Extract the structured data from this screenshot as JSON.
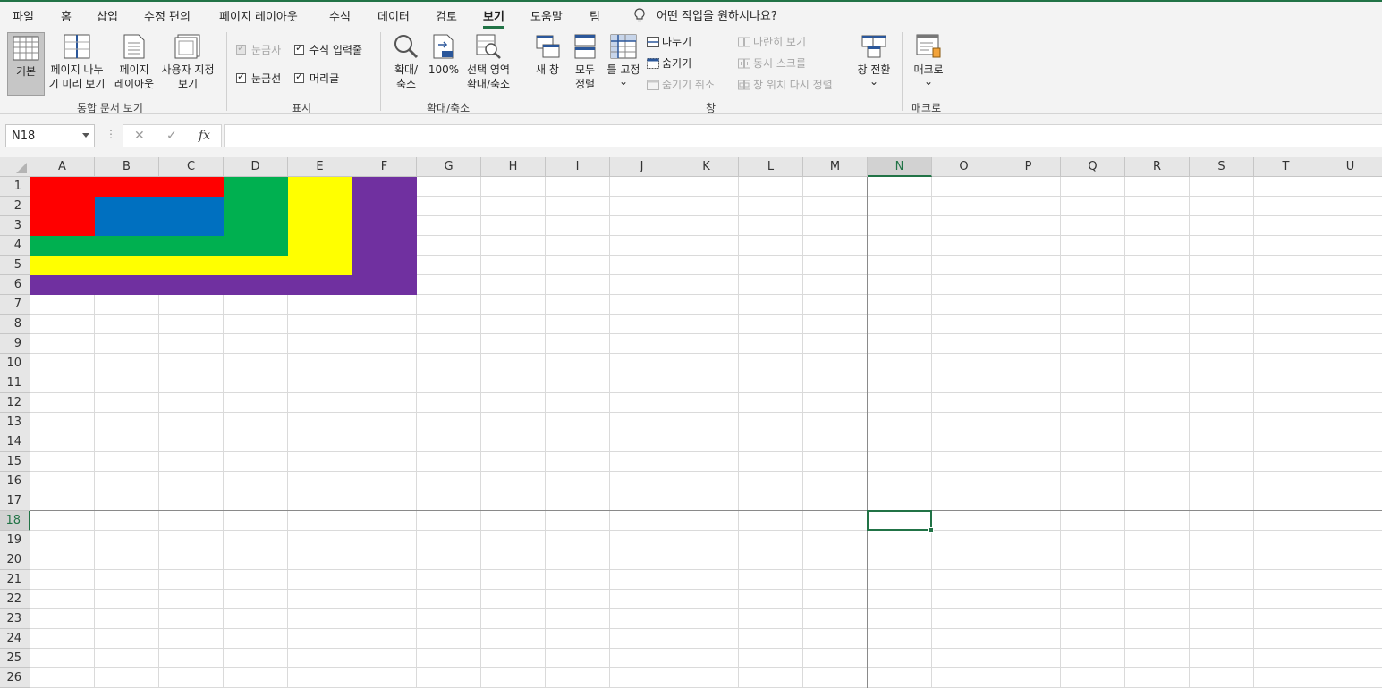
{
  "menu": {
    "items": [
      "파일",
      "홈",
      "삽입",
      "수정 편의",
      "페이지 레이아웃",
      "수식",
      "데이터",
      "검토",
      "보기",
      "도움말",
      "팀"
    ],
    "active": "보기",
    "tell_me": "어떤 작업을 원하시나요?"
  },
  "ribbon": {
    "workbook_views": {
      "group_label": "통합 문서 보기",
      "normal": "기본",
      "page_break": "페이지 나누\n기 미리 보기",
      "page_layout": "페이지\n레이아웃",
      "custom_views": "사용자 지정\n보기"
    },
    "show": {
      "group_label": "표시",
      "ruler": "눈금자",
      "formula_bar": "수식 입력줄",
      "gridlines": "눈금선",
      "headings": "머리글"
    },
    "zoom": {
      "group_label": "확대/축소",
      "zoom": "확대/\n축소",
      "hundred": "100%",
      "zoom_selection": "선택 영역\n확대/축소"
    },
    "window": {
      "group_label": "창",
      "new_window": "새 창",
      "arrange_all": "모두\n정렬",
      "freeze_panes": "틀 고정",
      "split": "나누기",
      "hide": "숨기기",
      "unhide": "숨기기 취소",
      "side_by_side": "나란히 보기",
      "sync_scroll": "동시 스크롤",
      "reset_position": "창 위치 다시 정렬",
      "switch_windows": "창 전환"
    },
    "macros": {
      "group_label": "매크로",
      "macros": "매크로"
    },
    "chevron": "⌄"
  },
  "formula_bar": {
    "name_box": "N18",
    "cancel": "✕",
    "enter": "✓",
    "fx": "fx",
    "dots": "⋮",
    "value": ""
  },
  "sheet": {
    "columns": [
      "A",
      "B",
      "C",
      "D",
      "E",
      "F",
      "G",
      "H",
      "I",
      "J",
      "K",
      "L",
      "M",
      "N",
      "O",
      "P",
      "Q",
      "R",
      "S",
      "T",
      "U"
    ],
    "rows": [
      "1",
      "2",
      "3",
      "4",
      "5",
      "6",
      "7",
      "8",
      "9",
      "10",
      "11",
      "12",
      "13",
      "14",
      "15",
      "16",
      "17",
      "18",
      "19",
      "20",
      "21",
      "22",
      "23",
      "24",
      "25",
      "26"
    ],
    "active_cell": "N18",
    "fills": [
      {
        "range": "A1:F6",
        "color": "#7030A0"
      },
      {
        "range": "A1:E5",
        "color": "#FFFF00"
      },
      {
        "range": "A1:D4",
        "color": "#00B050"
      },
      {
        "range": "A1:C3",
        "color": "#FF0000"
      },
      {
        "range": "B2:C3",
        "color": "#0070C0"
      }
    ]
  }
}
